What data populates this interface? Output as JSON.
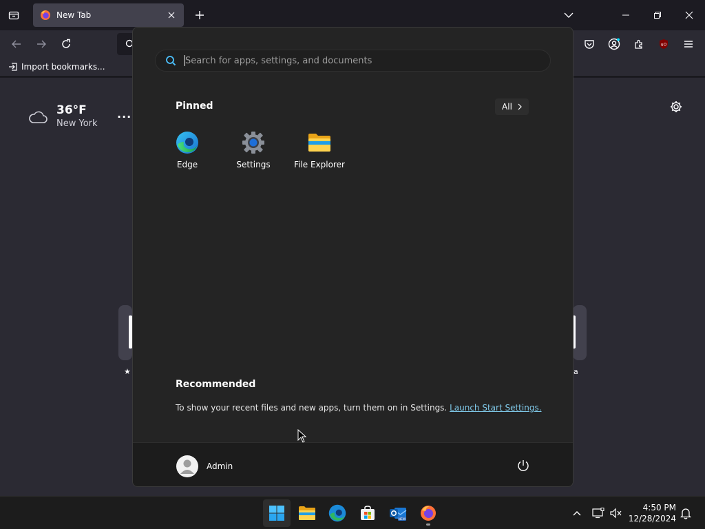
{
  "browser": {
    "tab_title": "New Tab",
    "bookmarks_import_label": "Import bookmarks..."
  },
  "newtab": {
    "weather": {
      "temperature": "36°F",
      "city": "New York",
      "more_label": "..."
    },
    "shortcut_labels": [
      "",
      "a"
    ]
  },
  "start_menu": {
    "search_placeholder": "Search for apps, settings, and documents",
    "pinned_title": "Pinned",
    "all_label": "All",
    "pinned_apps": [
      {
        "label": "Edge",
        "icon": "edge-icon"
      },
      {
        "label": "Settings",
        "icon": "settings-icon"
      },
      {
        "label": "File Explorer",
        "icon": "file-explorer-icon"
      }
    ],
    "recommended_title": "Recommended",
    "recommended_text": "To show your recent files and new apps, turn them on in Settings.",
    "recommended_link": "Launch Start Settings.",
    "user_name": "Admin"
  },
  "taskbar": {
    "apps": [
      "start-icon",
      "file-explorer-icon",
      "edge-icon",
      "store-icon",
      "outlook-icon",
      "firefox-icon"
    ],
    "clock_time": "4:50 PM",
    "clock_date": "12/28/2024"
  },
  "colors": {
    "accent_link": "#7fc8e8",
    "start_bg": "#242424",
    "browser_bg": "#2b2a33"
  }
}
